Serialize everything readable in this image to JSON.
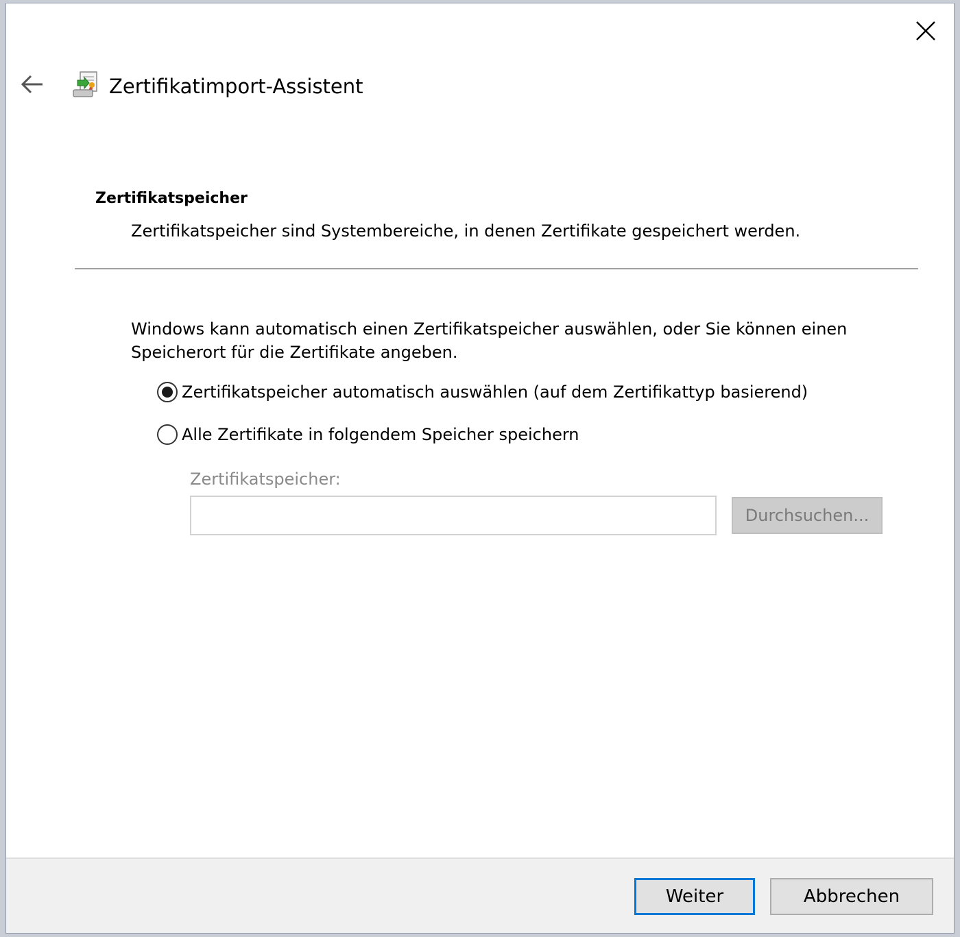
{
  "window": {
    "title": "Zertifikatimport-Assistent"
  },
  "section": {
    "heading": "Zertifikatspeicher",
    "description": "Zertifikatspeicher sind Systembereiche, in denen Zertifikate gespeichert werden."
  },
  "body": {
    "intro": "Windows kann automatisch einen Zertifikatspeicher auswählen, oder Sie können einen Speicherort für die Zertifikate angeben.",
    "options": [
      {
        "label": "Zertifikatspeicher automatisch auswählen (auf dem Zertifikattyp basierend)",
        "selected": true
      },
      {
        "label": "Alle Zertifikate in folgendem Speicher speichern",
        "selected": false
      }
    ],
    "store_label": "Zertifikatspeicher:",
    "store_value": "",
    "browse_label": "Durchsuchen..."
  },
  "footer": {
    "next_label": "Weiter",
    "cancel_label": "Abbrechen"
  },
  "colors": {
    "accent": "#0078d7",
    "disabled_text": "#8a8a8a",
    "footer_bg": "#f0f0f0"
  },
  "icons": {
    "close": "close-icon",
    "back": "back-arrow-icon",
    "app": "certificate-import-icon"
  }
}
